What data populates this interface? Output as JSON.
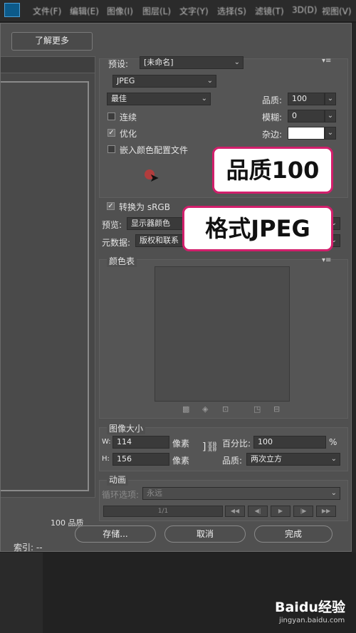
{
  "menubar": {
    "items": [
      "文件(F)",
      "编辑(E)",
      "图像(I)",
      "图层(L)",
      "文字(Y)",
      "选择(S)",
      "滤镜(T)",
      "3D(D)",
      "视图(V)"
    ]
  },
  "dialog": {
    "learn_more_label": "了解更多",
    "preview": {
      "quality_text": "100 品质",
      "index_text": "索引: --"
    },
    "preset": {
      "label": "预设:",
      "value": "[未命名]"
    },
    "format": {
      "value": "JPEG"
    },
    "quality_preset": {
      "value": "最佳"
    },
    "quality": {
      "label": "品质:",
      "value": "100"
    },
    "progressive": {
      "label": "连续",
      "checked": false
    },
    "blur": {
      "label": "模糊:",
      "value": "0"
    },
    "optimized": {
      "label": "优化",
      "checked": true
    },
    "matte": {
      "label": "杂边:",
      "color": "#ffffff"
    },
    "embed_profile": {
      "label": "嵌入颜色配置文件",
      "checked": false
    },
    "convert_srgb": {
      "label": "转换为 sRGB",
      "checked": true
    },
    "preview_mode": {
      "label": "预览:",
      "value": "显示器颜色"
    },
    "metadata": {
      "label": "元数据:",
      "value": "版权和联系"
    },
    "color_table": {
      "title": "颜色表"
    },
    "image_size": {
      "title": "图像大小",
      "w_label": "W:",
      "w_value": "114",
      "w_unit": "像素",
      "h_label": "H:",
      "h_value": "156",
      "h_unit": "像素",
      "percent_label": "百分比:",
      "percent_value": "100",
      "percent_unit": "%",
      "quality_label": "品质:",
      "quality_value": "两次立方"
    },
    "animation": {
      "title": "动画",
      "loop_label": "循环选项:",
      "loop_value": "永远",
      "frame_counter": "1/1"
    },
    "buttons": {
      "save": "存储...",
      "cancel": "取消",
      "done": "完成"
    }
  },
  "annotations": {
    "callout_quality": "品质100",
    "callout_format": "格式JPEG"
  },
  "watermark": {
    "brand": "Baidu经验",
    "url": "jingyan.baidu.com"
  },
  "colors": {
    "callout_border": "#d21f6c",
    "dialog_bg": "#505050"
  }
}
